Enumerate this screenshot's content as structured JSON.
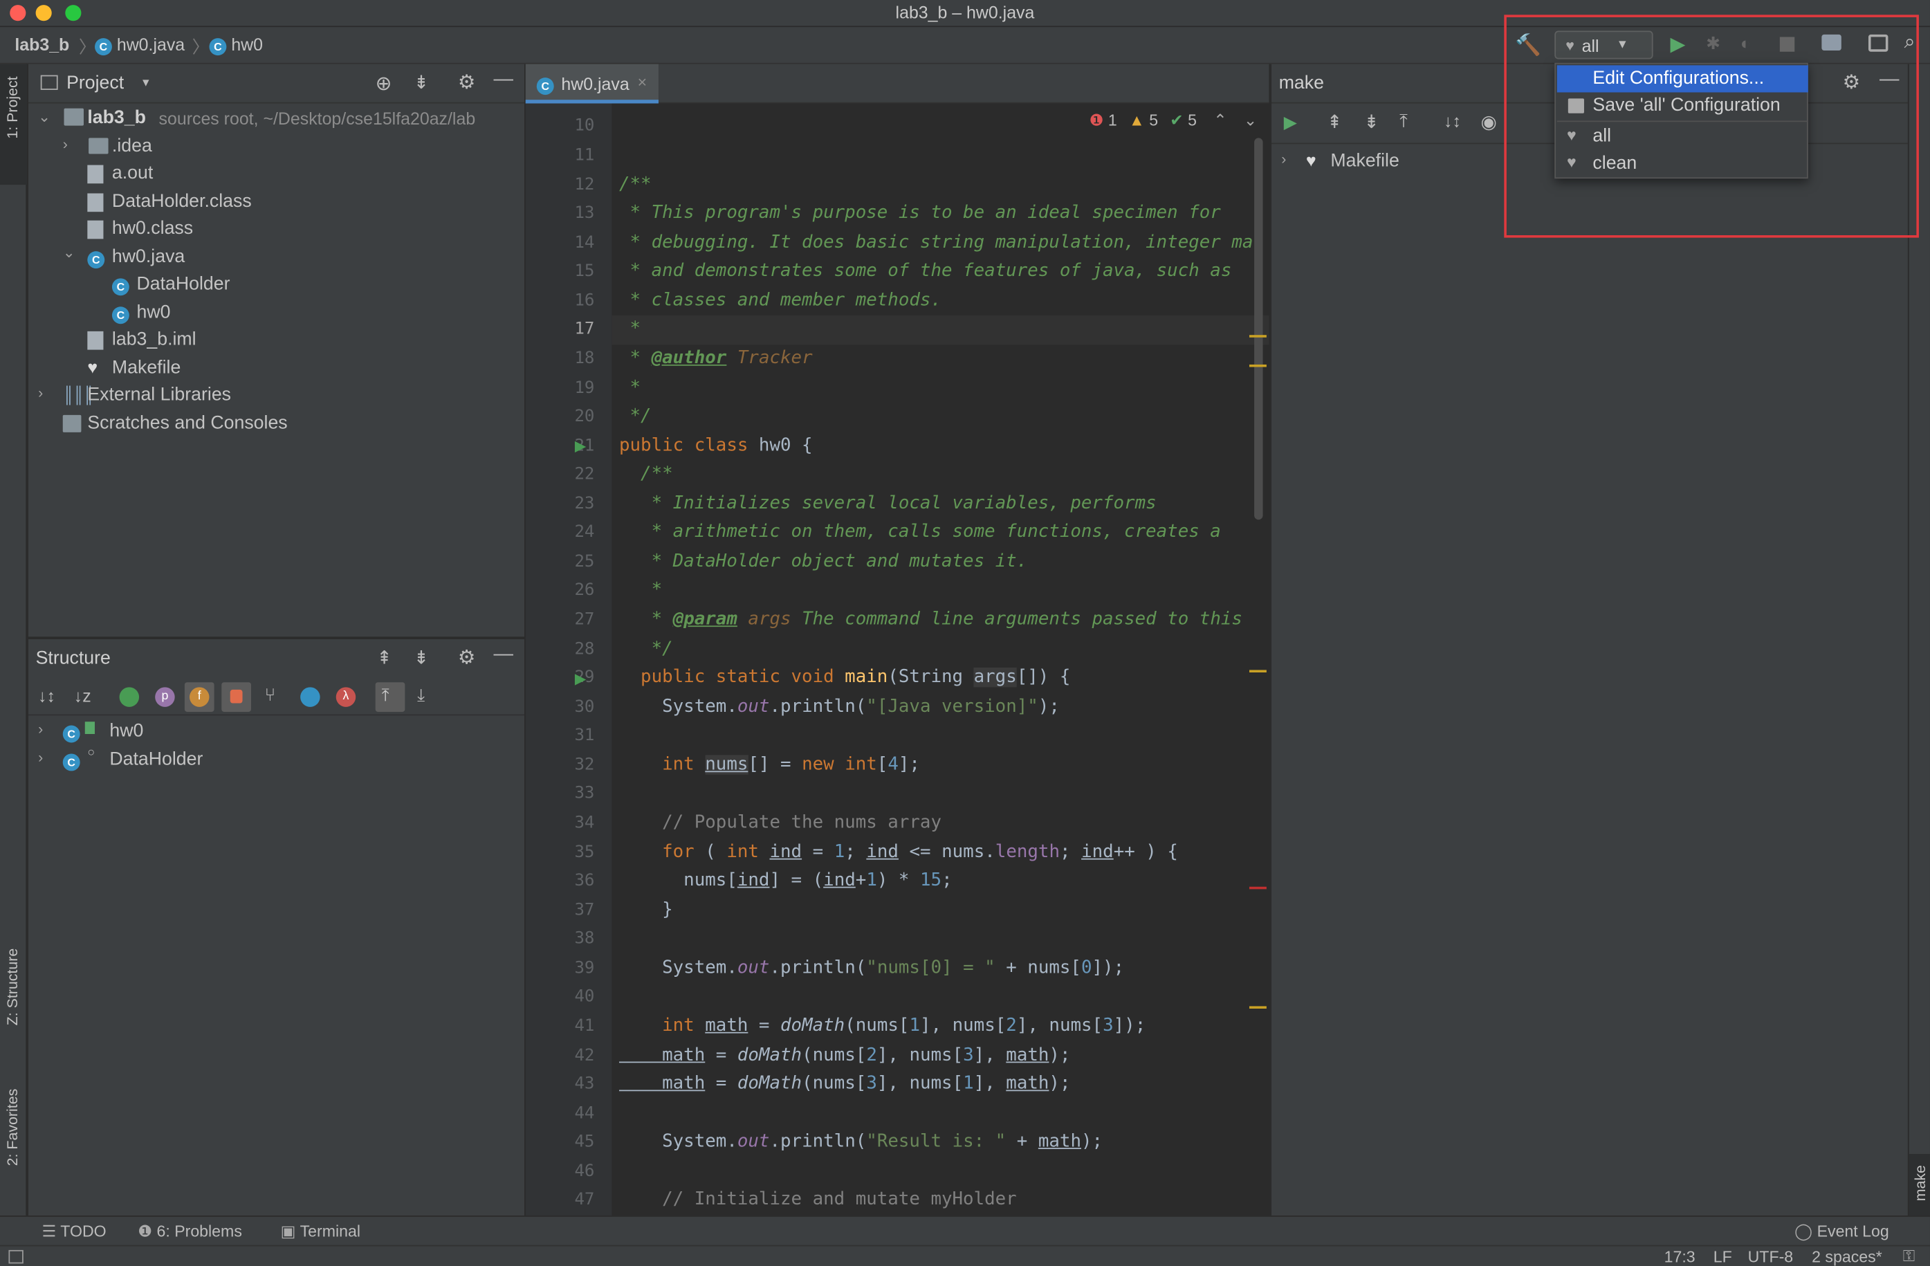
{
  "window": {
    "title": "lab3_b – hw0.java"
  },
  "breadcrumb": [
    "lab3_b",
    "hw0.java",
    "hw0"
  ],
  "run_config": {
    "selected": "all"
  },
  "run_menu": {
    "items": [
      "Edit Configurations...",
      "Save 'all' Configuration",
      "all",
      "clean"
    ]
  },
  "left_tabs": {
    "project": "1: Project",
    "structure": "Z: Structure",
    "favorites": "2: Favorites"
  },
  "project_panel": {
    "title": "Project",
    "root_name": "lab3_b",
    "root_hint": "sources root, ~/Desktop/cse15lfa20az/lab",
    "items": [
      ".idea",
      "a.out",
      "DataHolder.class",
      "hw0.class",
      "hw0.java",
      "DataHolder",
      "hw0",
      "lab3_b.iml",
      "Makefile",
      "External Libraries",
      "Scratches and Consoles"
    ]
  },
  "structure_panel": {
    "title": "Structure",
    "items": [
      "hw0",
      "DataHolder"
    ]
  },
  "editor": {
    "tab": "hw0.java",
    "inspections": {
      "errors": "1",
      "warnings": "5",
      "ok": "5"
    },
    "line_numbers": [
      "10",
      "11",
      "12",
      "13",
      "14",
      "15",
      "16",
      "17",
      "18",
      "19",
      "20",
      "21",
      "22",
      "23",
      "24",
      "25",
      "26",
      "27",
      "28",
      "29",
      "30",
      "31",
      "32",
      "33",
      "34",
      "35",
      "36",
      "37",
      "38",
      "39",
      "40",
      "41",
      "42",
      "43",
      "44",
      "45",
      "46",
      "47"
    ],
    "code": {
      "l12": "/**",
      "l13": " * This program's purpose is to be an ideal specimen for",
      "l14": " * debugging. It does basic string manipulation, integer ma",
      "l15": " * and demonstrates some of the features of java, such as",
      "l16": " * classes and member methods.",
      "l17": " *",
      "l18_pre": " * ",
      "l18_tag": "@author",
      "l18_val": " Tracker",
      "l19": " *",
      "l20": " */",
      "l21_kw": "public class",
      "l21_name": " hw0 {",
      "l22": "  /**",
      "l23": "   * Initializes several local variables, performs",
      "l24": "   * arithmetic on them, calls some functions, creates a",
      "l25": "   * DataHolder object and mutates it.",
      "l26": "   *",
      "l27_pre": "   * ",
      "l27_tag": "@param",
      "l27_arg": " args",
      "l27_rest": " The command line arguments passed to this",
      "l28": "   */",
      "l29_kw": "  public static void ",
      "l29_fn": "main",
      "l29_a": "(String ",
      "l29_b": "args",
      "l29_c": "[]) {",
      "l30_a": "    System.",
      "l30_b": "out",
      "l30_c": ".println(",
      "l30_d": "\"[Java version]\"",
      "l30_e": ");",
      "l32_kw": "    int ",
      "l32_v": "nums",
      "l32_a": "[] = ",
      "l32_kw2": "new int",
      "l32_b": "[",
      "l32_n": "4",
      "l32_c": "];",
      "l34": "    // Populate the nums array",
      "l35_kw": "    for",
      "l35_a": " ( ",
      "l35_kw2": "int ",
      "l35_v1": "ind",
      "l35_b": " = ",
      "l35_n": "1",
      "l35_c": "; ",
      "l35_v2": "ind",
      "l35_d": " <= nums.",
      "l35_e": "length",
      "l35_f": "; ",
      "l35_v3": "ind",
      "l35_g": "++ ) {",
      "l36_a": "      nums[",
      "l36_v1": "ind",
      "l36_b": "] = (",
      "l36_v2": "ind",
      "l36_c": "+",
      "l36_n1": "1",
      "l36_d": ") * ",
      "l36_n2": "15",
      "l36_e": ";",
      "l37": "    }",
      "l39_a": "    System.",
      "l39_b": "out",
      "l39_c": ".println(",
      "l39_d": "\"nums[0] = \"",
      "l39_e": " + nums[",
      "l39_n": "0",
      "l39_f": "]);",
      "l41_kw": "    int ",
      "l41_v": "math",
      "l41_a": " = ",
      "l41_fn": "doMath",
      "l41_b": "(nums[",
      "l41_n1": "1",
      "l41_c": "], nums[",
      "l41_n2": "2",
      "l41_d": "], nums[",
      "l41_n3": "3",
      "l41_e": "]);",
      "l42_v": "    math",
      "l42_a": " = ",
      "l42_fn": "doMath",
      "l42_b": "(nums[",
      "l42_n1": "2",
      "l42_c": "], nums[",
      "l42_n2": "3",
      "l42_d": "], ",
      "l42_v2": "math",
      "l42_e": ");",
      "l43_v": "    math",
      "l43_a": " = ",
      "l43_fn": "doMath",
      "l43_b": "(nums[",
      "l43_n1": "3",
      "l43_c": "], nums[",
      "l43_n2": "1",
      "l43_d": "], ",
      "l43_v2": "math",
      "l43_e": ");",
      "l45_a": "    System.",
      "l45_b": "out",
      "l45_c": ".println(",
      "l45_d": "\"Result is: \"",
      "l45_e": " + ",
      "l45_v": "math",
      "l45_f": ");",
      "l47": "    // Initialize and mutate myHolder"
    }
  },
  "make_panel": {
    "title": "make",
    "tree_item": "Makefile",
    "side_tab": "make"
  },
  "bottom_tabs": {
    "todo": "TODO",
    "problems": "6: Problems",
    "terminal": "Terminal",
    "event_log": "Event Log"
  },
  "status": {
    "position": "17:3",
    "line_sep": "LF",
    "encoding": "UTF-8",
    "indent": "2 spaces*"
  }
}
